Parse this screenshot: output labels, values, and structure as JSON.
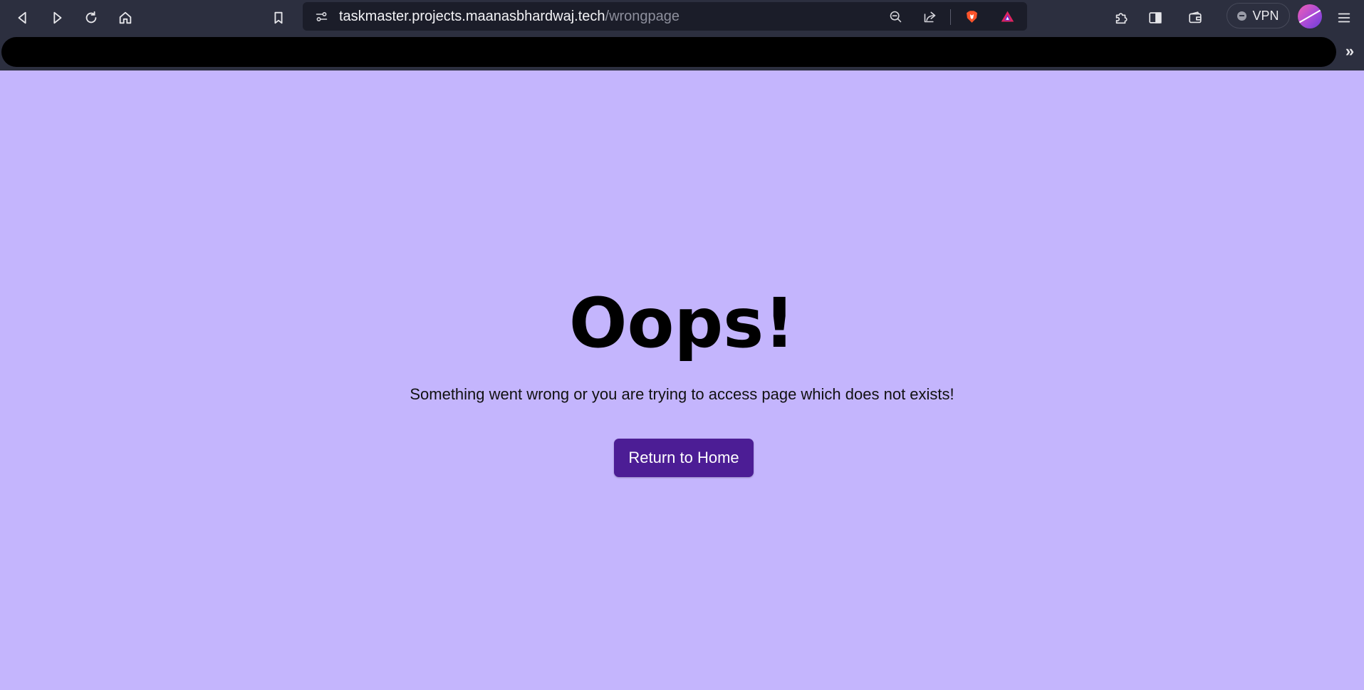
{
  "browser": {
    "url_host": "taskmaster.projects.maanasbhardwaj.tech",
    "url_path": "/wrongpage",
    "vpn_label": "VPN",
    "bookmarks_overflow": "»",
    "icons": [
      "back-icon",
      "forward-icon",
      "reload-icon",
      "home-icon",
      "bookmark-icon",
      "site-settings-icon",
      "zoom-out-icon",
      "share-icon",
      "brave-shields-icon",
      "brave-rewards-icon",
      "extensions-icon",
      "sidebar-icon",
      "wallet-icon",
      "menu-icon"
    ]
  },
  "page": {
    "title": "Oops!",
    "message": "Something went wrong or you are trying to access page which does not exists!",
    "button_label": "Return to Home"
  },
  "colors": {
    "page_background": "#c4b5fd",
    "button_background": "#4c1d95",
    "toolbar_background": "#2c2f3f"
  }
}
